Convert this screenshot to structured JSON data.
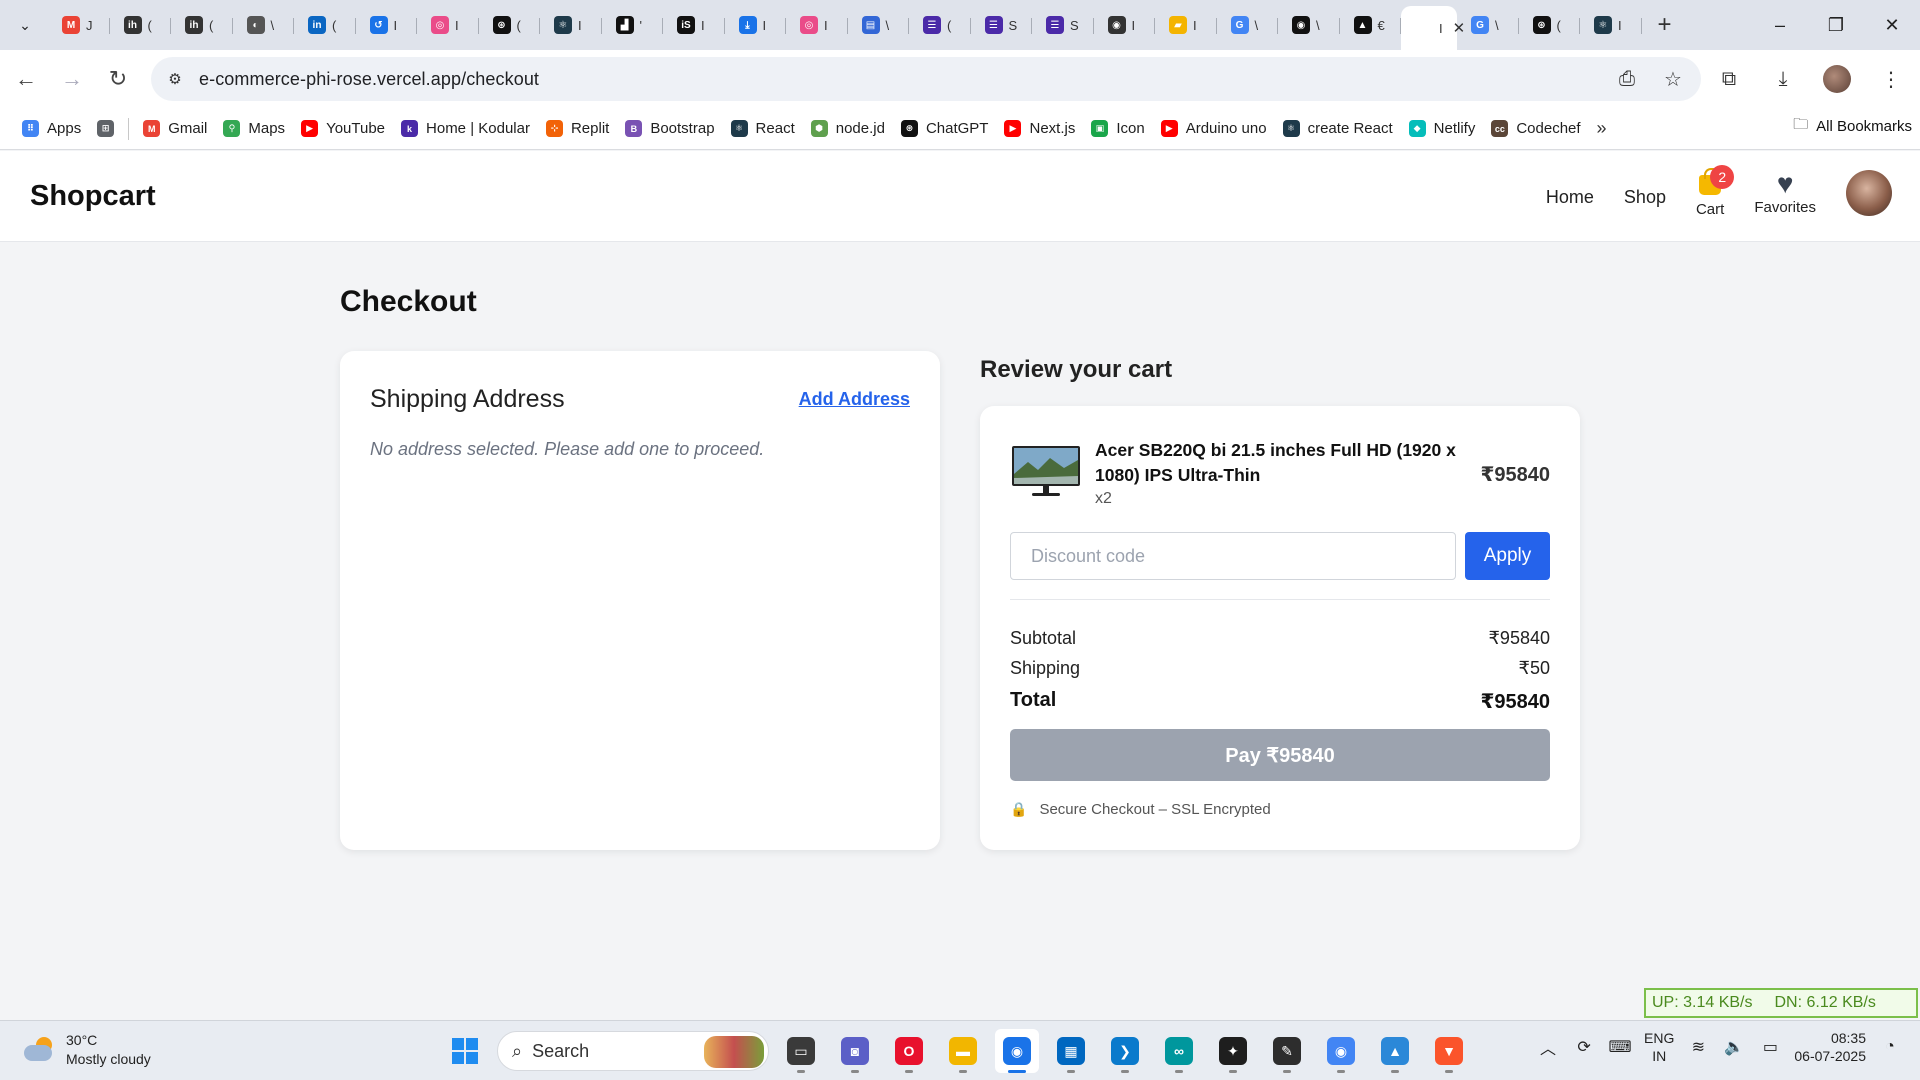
{
  "browser": {
    "tabs": [
      {
        "label": "J",
        "icon": "gmail-icon",
        "color": "#ea4335",
        "glyph": "M"
      },
      {
        "label": "(",
        "icon": "interviewbit-icon",
        "color": "#333333",
        "glyph": "ih"
      },
      {
        "label": "(",
        "icon": "interviewbit-icon",
        "color": "#333333",
        "glyph": "ih"
      },
      {
        "label": "\\",
        "icon": "globe-icon",
        "color": "#555555",
        "glyph": "◐"
      },
      {
        "label": "(",
        "icon": "linkedin-icon",
        "color": "#0a66c2",
        "glyph": "in"
      },
      {
        "label": "I",
        "icon": "history-icon",
        "color": "#1a73e8",
        "glyph": "↺"
      },
      {
        "label": "I",
        "icon": "dribbble-icon",
        "color": "#ea4c89",
        "glyph": "◎"
      },
      {
        "label": "(",
        "icon": "openai-icon",
        "color": "#111111",
        "glyph": "⊛"
      },
      {
        "label": "I",
        "icon": "react-icon",
        "color": "#1e3a4a",
        "glyph": "⚛"
      },
      {
        "label": "'",
        "icon": "unsplash-icon",
        "color": "#111111",
        "glyph": "▟"
      },
      {
        "label": "I",
        "icon": "istockphoto-icon",
        "color": "#111111",
        "glyph": "iS"
      },
      {
        "label": "I",
        "icon": "download-icon",
        "color": "#1a73e8",
        "glyph": "⤓"
      },
      {
        "label": "I",
        "icon": "dribbble-icon",
        "color": "#ea4c89",
        "glyph": "◎"
      },
      {
        "label": "\\",
        "icon": "forms-icon",
        "color": "#3367d6",
        "glyph": "▤"
      },
      {
        "label": "(",
        "icon": "docs-icon",
        "color": "#4b2aa8",
        "glyph": "☰"
      },
      {
        "label": "S",
        "icon": "docs-icon",
        "color": "#4b2aa8",
        "glyph": "☰"
      },
      {
        "label": "S",
        "icon": "docs-icon",
        "color": "#4b2aa8",
        "glyph": "☰"
      },
      {
        "label": "I",
        "icon": "github-icon",
        "color": "#333333",
        "glyph": "◉"
      },
      {
        "label": "I",
        "icon": "course-icon",
        "color": "#f4b400",
        "glyph": "▰"
      },
      {
        "label": "\\",
        "icon": "google-icon",
        "color": "#4285f4",
        "glyph": "G"
      },
      {
        "label": "\\",
        "icon": "github-icon",
        "color": "#111111",
        "glyph": "◉"
      },
      {
        "label": "€",
        "icon": "vercel-icon",
        "color": "#111111",
        "glyph": "▲"
      },
      {
        "label": "I",
        "icon": "page-icon",
        "color": "#ffffff",
        "glyph": "",
        "active": true
      },
      {
        "label": "\\",
        "icon": "google-icon",
        "color": "#4285f4",
        "glyph": "G"
      },
      {
        "label": "(",
        "icon": "openai-icon",
        "color": "#111111",
        "glyph": "⊛"
      },
      {
        "label": "I",
        "icon": "react-icon",
        "color": "#1e3a4a",
        "glyph": "⚛"
      }
    ],
    "url": "e-commerce-phi-rose.vercel.app/checkout",
    "bookmarks": [
      {
        "label": "Apps",
        "icon": "apps-grid-icon",
        "color": "#4285f4",
        "glyph": "⠿"
      },
      {
        "label": "",
        "icon": "tab-groups-icon",
        "color": "#5f6368",
        "glyph": "⊞"
      },
      {
        "label": "Gmail",
        "icon": "gmail-icon",
        "color": "#ea4335",
        "glyph": "M"
      },
      {
        "label": "Maps",
        "icon": "maps-icon",
        "color": "#34a853",
        "glyph": "⚲"
      },
      {
        "label": "YouTube",
        "icon": "youtube-icon",
        "color": "#ff0000",
        "glyph": "▶"
      },
      {
        "label": "Home | Kodular",
        "icon": "kodular-icon",
        "color": "#4b2aa8",
        "glyph": "k"
      },
      {
        "label": "Replit",
        "icon": "replit-icon",
        "color": "#f26207",
        "glyph": "⊹"
      },
      {
        "label": "Bootstrap",
        "icon": "bootstrap-icon",
        "color": "#7952b3",
        "glyph": "B"
      },
      {
        "label": "React",
        "icon": "react-icon",
        "color": "#1e3a4a",
        "glyph": "⚛"
      },
      {
        "label": "node.jd",
        "icon": "nodejs-icon",
        "color": "#5fa04e",
        "glyph": "⬢"
      },
      {
        "label": "ChatGPT",
        "icon": "openai-icon",
        "color": "#111111",
        "glyph": "⊛"
      },
      {
        "label": "Next.js",
        "icon": "youtube-icon",
        "color": "#ff0000",
        "glyph": "▶"
      },
      {
        "label": "Icon",
        "icon": "icon-site-icon",
        "color": "#1aa64a",
        "glyph": "▣"
      },
      {
        "label": "Arduino uno",
        "icon": "youtube-icon",
        "color": "#ff0000",
        "glyph": "▶"
      },
      {
        "label": "create React",
        "icon": "react-icon",
        "color": "#1e3a4a",
        "glyph": "⚛"
      },
      {
        "label": "Netlify",
        "icon": "netlify-icon",
        "color": "#05bdba",
        "glyph": "◆"
      },
      {
        "label": "Codechef",
        "icon": "codechef-icon",
        "color": "#5b4638",
        "glyph": "cc"
      }
    ],
    "all_bookmarks": "All Bookmarks"
  },
  "site": {
    "brand": "Shopcart",
    "nav": {
      "home": "Home",
      "shop": "Shop",
      "cart": "Cart",
      "cart_count": "2",
      "favorites": "Favorites"
    }
  },
  "checkout": {
    "title": "Checkout",
    "shipping": {
      "title": "Shipping Address",
      "add_link": "Add Address",
      "empty_message": "No address selected. Please add one to proceed."
    },
    "review": {
      "title": "Review your cart",
      "item": {
        "name": "Acer SB220Q bi 21.5 inches Full HD (1920 x 1080) IPS Ultra-Thin",
        "qty": "x2",
        "price": "₹95840"
      },
      "discount_placeholder": "Discount code",
      "apply_label": "Apply",
      "subtotal_label": "Subtotal",
      "subtotal_value": "₹95840",
      "shipping_label": "Shipping",
      "shipping_value": "₹50",
      "total_label": "Total",
      "total_value": "₹95840",
      "pay_label": "Pay ₹95840",
      "secure_note": "Secure Checkout – SSL Encrypted"
    }
  },
  "overlay": {
    "upload": "UP: 3.14 KB/s",
    "download": "DN: 6.12 KB/s"
  },
  "taskbar": {
    "temperature": "30°C",
    "condition": "Mostly cloudy",
    "search": "Search",
    "lang_top": "ENG",
    "lang_bottom": "IN",
    "time": "08:35",
    "date": "06-07-2025",
    "apps": [
      {
        "icon": "task-view-icon",
        "color": "#3a3a3a",
        "glyph": "▭"
      },
      {
        "icon": "teams-icon",
        "color": "#5b5fc7",
        "glyph": "◙"
      },
      {
        "icon": "opera-icon",
        "color": "#e8112d",
        "glyph": "O"
      },
      {
        "icon": "file-explorer-icon",
        "color": "#f2b600",
        "glyph": "▬"
      },
      {
        "icon": "chrome-icon",
        "color": "#1a73e8",
        "glyph": "◉",
        "active": true
      },
      {
        "icon": "store-icon",
        "color": "#0067c0",
        "glyph": "▦"
      },
      {
        "icon": "vscode-icon",
        "color": "#0a7acc",
        "glyph": "❯"
      },
      {
        "icon": "arduino-icon",
        "color": "#00979d",
        "glyph": "∞"
      },
      {
        "icon": "figma-icon",
        "color": "#1e1e1e",
        "glyph": "✦"
      },
      {
        "icon": "sketch-app-icon",
        "color": "#2d2d2d",
        "glyph": "✎"
      },
      {
        "icon": "chrome-canary-icon",
        "color": "#4285f4",
        "glyph": "◉"
      },
      {
        "icon": "photos-icon",
        "color": "#2b88d8",
        "glyph": "▲"
      },
      {
        "icon": "brave-icon",
        "color": "#fb542b",
        "glyph": "▼"
      }
    ]
  }
}
